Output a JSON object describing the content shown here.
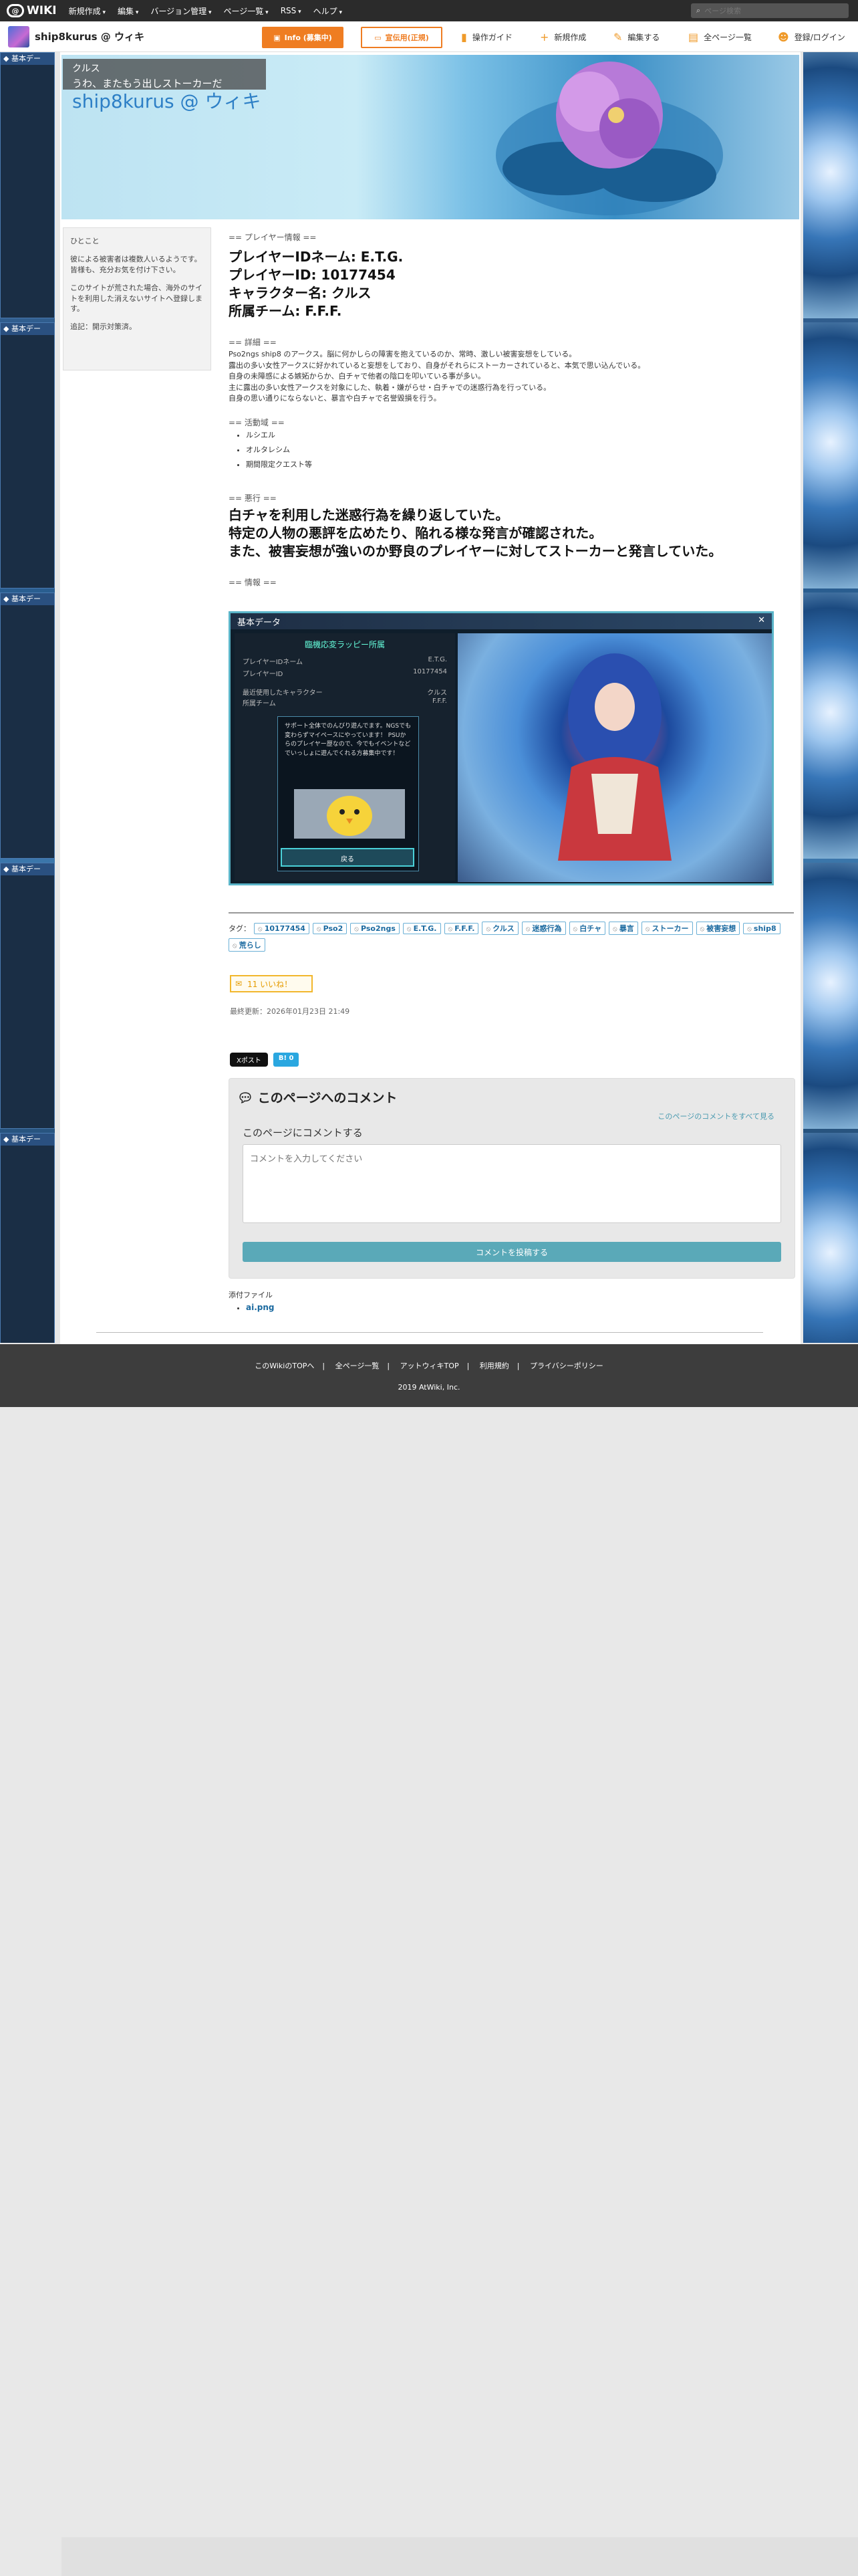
{
  "topbar": {
    "logo": "WIKI",
    "menus": [
      "新規作成",
      "編集",
      "バージョン管理",
      "ページ一覧",
      "RSS",
      "ヘルプ"
    ],
    "search_placeholder": "ページ検索"
  },
  "sitebar": {
    "site_name": "ship8kurus @ ウィキ",
    "btn_info": "Info (募集中)",
    "btn_promo": "宣伝用(正規)",
    "tools": [
      "操作ガイド",
      "新規作成",
      "編集する",
      "全ページ一覧",
      "登録/ログイン"
    ]
  },
  "header": {
    "breadcrumb": "クルス",
    "subtitle": "うわ、またもう出しストーカーだ",
    "wiki_title": "ship8kurus @ ウィキ"
  },
  "sidebox": {
    "title": "ひとこと",
    "p1": "彼による被害者は複数人いるようです。皆様も、充分お気を付け下さい。",
    "p2": "このサイトが荒された場合、海外のサイトを利用した消えないサイトへ登録します。",
    "p3": "追記：開示対策済。"
  },
  "content": {
    "sec1": "== プレイヤー情報 ==",
    "player_lines": [
      "プレイヤーIDネーム: E.T.G.",
      "プレイヤーID: 10177454",
      "キャラクター名: クルス",
      "所属チーム: F.F.F."
    ],
    "sec2": "== 詳細 ==",
    "detail_lines": [
      "Pso2ngs ship8 のアークス。脳に何かしらの障害を抱えているのか、常時、激しい被害妄想をしている。",
      "露出の多い女性アークスに好かれていると妄想をしており、自身がそれらにストーカーされていると、本気で思い込んでいる。",
      "自身の未障感による嫉妬からか、白チャで他者の陰口を叩いている事が多い。",
      "主に露出の多い女性アークスを対象にした、執着・嫌がらせ・白チャでの迷惑行為を行っている。",
      "自身の思い通りにならないと、暴言や白チャで名誉毀損を行う。"
    ],
    "sec3": "== 活動域 ==",
    "areas": [
      "ルシエル",
      "オルタレシム",
      "期間限定クエスト等"
    ],
    "sec4": "== 悪行 ==",
    "bad_lines": [
      "白チャを利用した迷惑行為を繰り返していた。",
      "特定の人物の悪評を広めたり、陥れる様な発言が確認された。",
      "また、被害妄想が強いのか野良のプレイヤーに対してストーカーと発言していた。"
    ],
    "sec5": "== 情報 =="
  },
  "screenshot": {
    "window_title": "基本データ",
    "panel_title": "臨機応変ラッピー所属",
    "rows": [
      {
        "k": "プレイヤーIDネーム",
        "v": "E.T.G."
      },
      {
        "k": "プレイヤーID",
        "v": "10177454"
      },
      {
        "k": "最近使用したキャラクター",
        "v": "クルス"
      },
      {
        "k": "所属チーム",
        "v": "F.F.F."
      }
    ],
    "dialog_text": "サポート全体でのんびり遊んでます。NGSでも変わらずマイペースにやっています！ PSUからのプレイヤー歴なので、今でもイベントなどでいっしょに遊んでくれる方募集中です！",
    "ok_label": "戻る"
  },
  "tags": {
    "label": "タグ：",
    "items": [
      "10177454",
      "Pso2",
      "Pso2ngs",
      "E.T.G.",
      "F.F.F.",
      "クルス",
      "迷惑行為",
      "白チャ",
      "暴言",
      "ストーカー",
      "被害妄想",
      "ship8",
      "荒らし"
    ]
  },
  "like_label": "11 いいね！",
  "updated": "最終更新：2026年01月23日 21:49",
  "social": {
    "post": "Xポスト",
    "b": "B! 0"
  },
  "comments": {
    "title": "このページへのコメント",
    "all_link": "このページのコメントをすべて見る",
    "label": "このページにコメントする",
    "placeholder": "コメントを入力してください",
    "submit": "コメントを投稿する"
  },
  "attach": {
    "label": "添付ファイル",
    "file": "ai.png"
  },
  "footer": {
    "links": [
      "このWikiのTOPへ",
      "全ページ一覧",
      "アットウィキTOP",
      "利用規約",
      "プライバシーポリシー"
    ],
    "copyright": "2019 AtWiki, Inc."
  }
}
